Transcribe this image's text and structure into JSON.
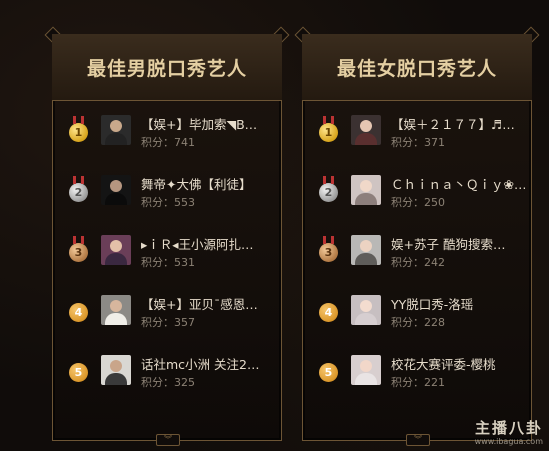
{
  "left_panel": {
    "title": "最佳男脱口秀艺人",
    "entries": [
      {
        "rank": "1",
        "name": "【娱+】毕加索◥B…",
        "score": "积分：741",
        "medal": "gold",
        "avatar_bg": "#2b2b2b",
        "avatar_skin": "#c9a98b",
        "avatar_cloth": "#222"
      },
      {
        "rank": "2",
        "name": "舞帝✦大佛【利徒】",
        "score": "积分：553",
        "medal": "silver",
        "avatar_bg": "#141414",
        "avatar_skin": "#b59680",
        "avatar_cloth": "#0b0b0b"
      },
      {
        "rank": "3",
        "name": "▸ｉＲ◂王小源阿扎…",
        "score": "积分：531",
        "medal": "bronze",
        "avatar_bg": "#6a3e58",
        "avatar_skin": "#e3c0a8",
        "avatar_cloth": "#3a2840"
      },
      {
        "rank": "4",
        "name": "【娱+】亚贝ˉ感恩…",
        "score": "积分：357",
        "medal": "plain",
        "avatar_bg": "#8c8a86",
        "avatar_skin": "#d7b69d",
        "avatar_cloth": "#f0eee8"
      },
      {
        "rank": "5",
        "name": "话社mc小洲 关注2…",
        "score": "积分：325",
        "medal": "plain",
        "avatar_bg": "#d9d7d2",
        "avatar_skin": "#c9a58a",
        "avatar_cloth": "#3a3a3a"
      }
    ]
  },
  "right_panel": {
    "title": "最佳女脱口秀艺人",
    "entries": [
      {
        "rank": "1",
        "name": "【娱＋２１７７】♬…",
        "score": "积分：371",
        "medal": "gold",
        "avatar_bg": "#3b3131",
        "avatar_skin": "#e5c6b2",
        "avatar_cloth": "#5a2f2f"
      },
      {
        "rank": "2",
        "name": "Ｃｈｉｎａ丶Ｑｉｙ❀…",
        "score": "积分：250",
        "medal": "silver",
        "avatar_bg": "#cfc4c2",
        "avatar_skin": "#f0d8c9",
        "avatar_cloth": "#8d7f7c"
      },
      {
        "rank": "3",
        "name": "娱+苏子 酷狗搜索…",
        "score": "积分：242",
        "medal": "bronze",
        "avatar_bg": "#b9b8b6",
        "avatar_skin": "#ecd3c2",
        "avatar_cloth": "#5f5d5a"
      },
      {
        "rank": "4",
        "name": "YY脱口秀-洛瑶",
        "score": "积分：228",
        "medal": "plain",
        "avatar_bg": "#c7bfc1",
        "avatar_skin": "#f3dccf",
        "avatar_cloth": "#d6ced0"
      },
      {
        "rank": "5",
        "name": "校花大赛评委-樱桃",
        "score": "积分：221",
        "medal": "plain",
        "avatar_bg": "#d8cfcf",
        "avatar_skin": "#f2d7c9",
        "avatar_cloth": "#e9e4e4"
      }
    ]
  },
  "watermark": {
    "title": "主播八卦",
    "url": "www.ibagua.com"
  }
}
